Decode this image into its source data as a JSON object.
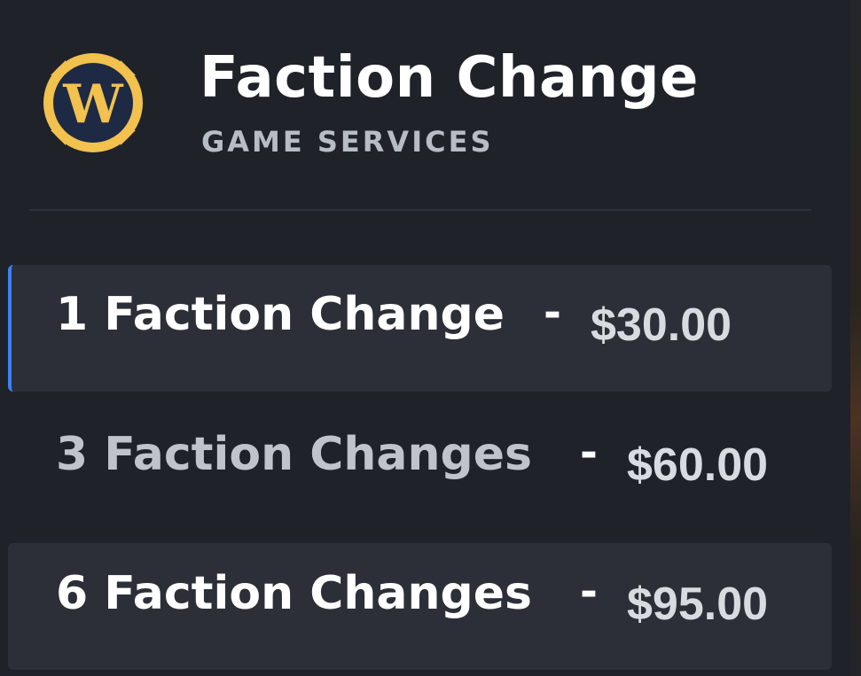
{
  "header": {
    "logo_letter": "W",
    "title": "Faction Change",
    "subtitle": "GAME SERVICES"
  },
  "options": [
    {
      "label": "1 Faction Change",
      "separator": "-",
      "price": "$30.00",
      "selected": true
    },
    {
      "label": "3 Faction Changes",
      "separator": "-",
      "price": "$60.00",
      "selected": false
    },
    {
      "label": "6 Faction Changes",
      "separator": "-",
      "price": "$95.00",
      "selected": false
    }
  ],
  "colors": {
    "background": "#1f2229",
    "option_background": "#2c2f37",
    "selected_accent": "#3b82f6",
    "logo_gold": "#f2c14e",
    "logo_navy": "#1e2a44"
  },
  "icons": {
    "logo": "wow-logo-icon"
  }
}
